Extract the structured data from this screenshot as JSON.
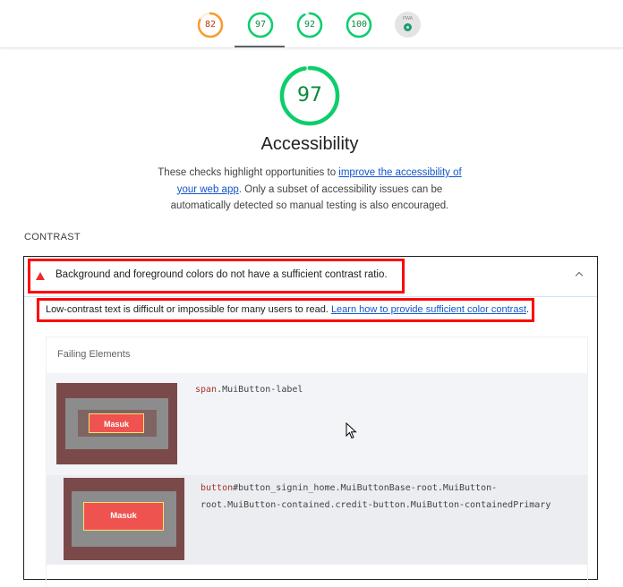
{
  "scores": [
    {
      "value": "82",
      "fraction": 0.82,
      "color": "#fa9a2e",
      "track": "#fdeedd",
      "text_color": "#c33300"
    },
    {
      "value": "97",
      "fraction": 0.97,
      "color": "#0cce6b",
      "track": "#e0f7ea",
      "text_color": "#0b8a3c"
    },
    {
      "value": "92",
      "fraction": 0.92,
      "color": "#0cce6b",
      "track": "#e0f7ea",
      "text_color": "#0b8a3c"
    },
    {
      "value": "100",
      "fraction": 1.0,
      "color": "#0cce6b",
      "track": "#e0f7ea",
      "text_color": "#0b8a3c"
    }
  ],
  "pwa_badge": {
    "label": "PWA",
    "icon": "pwa-icon"
  },
  "category": {
    "score": "97",
    "score_fraction": 0.97,
    "title": "Accessibility",
    "desc_before": "These checks highlight opportunities to ",
    "desc_link": "improve the accessibility of your web app",
    "desc_after": ". Only a subset of accessibility issues can be automatically detected so manual testing is also encouraged."
  },
  "group": {
    "title": "CONTRAST"
  },
  "audit": {
    "title": "Background and foreground colors do not have a sufficient contrast ratio.",
    "status_icon": "fail-triangle-icon",
    "desc_before": "Low-contrast text is difficult or impossible for many users to read. ",
    "desc_link": "Learn how to provide sufficient color contrast",
    "desc_after": "."
  },
  "failing_elements": {
    "header": "Failing Elements",
    "rows": [
      {
        "selector_tag": "span",
        "selector_rest": ".MuiButton-label",
        "thumb_label": "Masuk"
      },
      {
        "selector_tag": "button",
        "selector_rest_line1": "#button_signin_home.MuiButtonBase-root.MuiButton-",
        "selector_rest_line2": "root.MuiButton-contained.credit-button.MuiButton-containedPrimary",
        "thumb_label": "Masuk"
      }
    ]
  },
  "colors": {
    "pass": "#0cce6b",
    "average": "#fa9a2e",
    "fail": "#ee2b2b",
    "link": "#1155cc",
    "highlight_box": "#ff0000"
  }
}
